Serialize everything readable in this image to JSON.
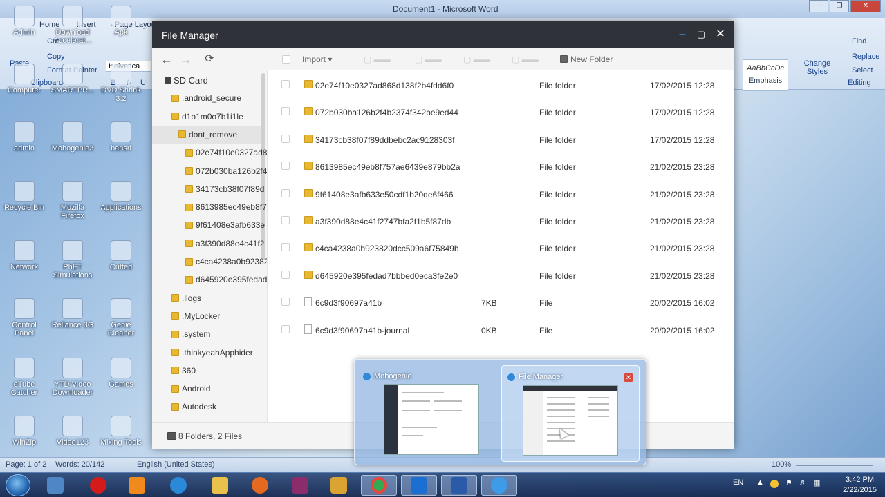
{
  "word": {
    "title": "Document1 - Microsoft Word",
    "tabs": [
      "Home",
      "Insert",
      "Page Layou"
    ],
    "clipboard": {
      "cut": "Cut",
      "copy": "Copy",
      "paste": "Paste",
      "format_painter": "Format Painter",
      "group_label": "Clipboard"
    },
    "font": "Helvetica",
    "styles": {
      "sample": "AaBbCcDc",
      "name": "Emphasis",
      "change_styles": "Change Styles"
    },
    "editing": {
      "find": "Find",
      "replace": "Replace",
      "select": "Select",
      "group_label": "Editing"
    },
    "status": {
      "page": "Page: 1 of 2",
      "words": "Words: 20/142",
      "language": "English (United States)",
      "zoom": "100%"
    }
  },
  "desktop_icons": [
    {
      "label": "Admin"
    },
    {
      "label": "Download Accelerat..."
    },
    {
      "label": "Apk"
    },
    {
      "label": "Computer"
    },
    {
      "label": "SMARTPR..."
    },
    {
      "label": "DVD Shrink 3.2"
    },
    {
      "label": "admin"
    },
    {
      "label": "Mobogenie3"
    },
    {
      "label": "bansri"
    },
    {
      "label": "Recycle Bin"
    },
    {
      "label": "Mozilla Firefox"
    },
    {
      "label": "Applications"
    },
    {
      "label": "Network"
    },
    {
      "label": "PhET Simulations"
    },
    {
      "label": "Cutted"
    },
    {
      "label": "Control Panel"
    },
    {
      "label": "Reliance 3G"
    },
    {
      "label": "Genie Cleaner"
    },
    {
      "label": "eTube Catcher"
    },
    {
      "label": "YTD Video Downloader"
    },
    {
      "label": "Games"
    },
    {
      "label": "WinZip"
    },
    {
      "label": "Video123"
    },
    {
      "label": "Mixing Tools"
    }
  ],
  "file_manager": {
    "title": "File Manager",
    "toolbar": {
      "import": "Import",
      "new_folder": "New Folder"
    },
    "tree": [
      {
        "label": "SD Card",
        "level": 0,
        "kind": "sd"
      },
      {
        "label": ".android_secure",
        "level": 1
      },
      {
        "label": "d1o1m0o7b1i1le",
        "level": 1
      },
      {
        "label": "dont_remove",
        "level": 2,
        "selected": true
      },
      {
        "label": "02e74f10e0327ad8",
        "level": 3
      },
      {
        "label": "072b030ba126b2f4",
        "level": 3
      },
      {
        "label": "34173cb38f07f89d",
        "level": 3
      },
      {
        "label": "8613985ec49eb8f7",
        "level": 3
      },
      {
        "label": "9f61408e3afb633e",
        "level": 3
      },
      {
        "label": "a3f390d88e4c41f2",
        "level": 3
      },
      {
        "label": "c4ca4238a0b92382",
        "level": 3
      },
      {
        "label": "d645920e395fedad",
        "level": 3
      },
      {
        "label": ".llogs",
        "level": 1
      },
      {
        "label": ".MyLocker",
        "level": 1
      },
      {
        "label": ".system",
        "level": 1
      },
      {
        "label": ".thinkyeahApphider",
        "level": 1
      },
      {
        "label": "360",
        "level": 1
      },
      {
        "label": "Android",
        "level": 1
      },
      {
        "label": "Autodesk",
        "level": 1
      }
    ],
    "files": [
      {
        "name": "02e74f10e0327ad868d138f2b4fdd6f0",
        "size": "",
        "type": "File folder",
        "date": "17/02/2015 12:28",
        "kind": "folder"
      },
      {
        "name": "072b030ba126b2f4b2374f342be9ed44",
        "size": "",
        "type": "File folder",
        "date": "17/02/2015 12:28",
        "kind": "folder"
      },
      {
        "name": "34173cb38f07f89ddbebc2ac9128303f",
        "size": "",
        "type": "File folder",
        "date": "17/02/2015 12:28",
        "kind": "folder"
      },
      {
        "name": "8613985ec49eb8f757ae6439e879bb2a",
        "size": "",
        "type": "File folder",
        "date": "21/02/2015 23:28",
        "kind": "folder"
      },
      {
        "name": "9f61408e3afb633e50cdf1b20de6f466",
        "size": "",
        "type": "File folder",
        "date": "21/02/2015 23:28",
        "kind": "folder"
      },
      {
        "name": "a3f390d88e4c41f2747bfa2f1b5f87db",
        "size": "",
        "type": "File folder",
        "date": "21/02/2015 23:28",
        "kind": "folder"
      },
      {
        "name": "c4ca4238a0b923820dcc509a6f75849b",
        "size": "",
        "type": "File folder",
        "date": "21/02/2015 23:28",
        "kind": "folder"
      },
      {
        "name": "d645920e395fedad7bbbed0eca3fe2e0",
        "size": "",
        "type": "File folder",
        "date": "21/02/2015 23:28",
        "kind": "folder"
      },
      {
        "name": "6c9d3f90697a41b",
        "size": "7KB",
        "type": "File",
        "date": "20/02/2015 16:02",
        "kind": "file"
      },
      {
        "name": "6c9d3f90697a41b-journal",
        "size": "0KB",
        "type": "File",
        "date": "20/02/2015 16:02",
        "kind": "file"
      }
    ],
    "footer": "8 Folders, 2 Files"
  },
  "preview": {
    "items": [
      {
        "title": "Mobogenie"
      },
      {
        "title": "File Manager"
      }
    ]
  },
  "taskbar": {
    "language": "EN",
    "time": "3:42 PM",
    "date": "2/22/2015"
  },
  "colors": {
    "fm_titlebar": "#2f3238",
    "folder": "#e8b830",
    "taskbar": "#1e3c6e"
  }
}
